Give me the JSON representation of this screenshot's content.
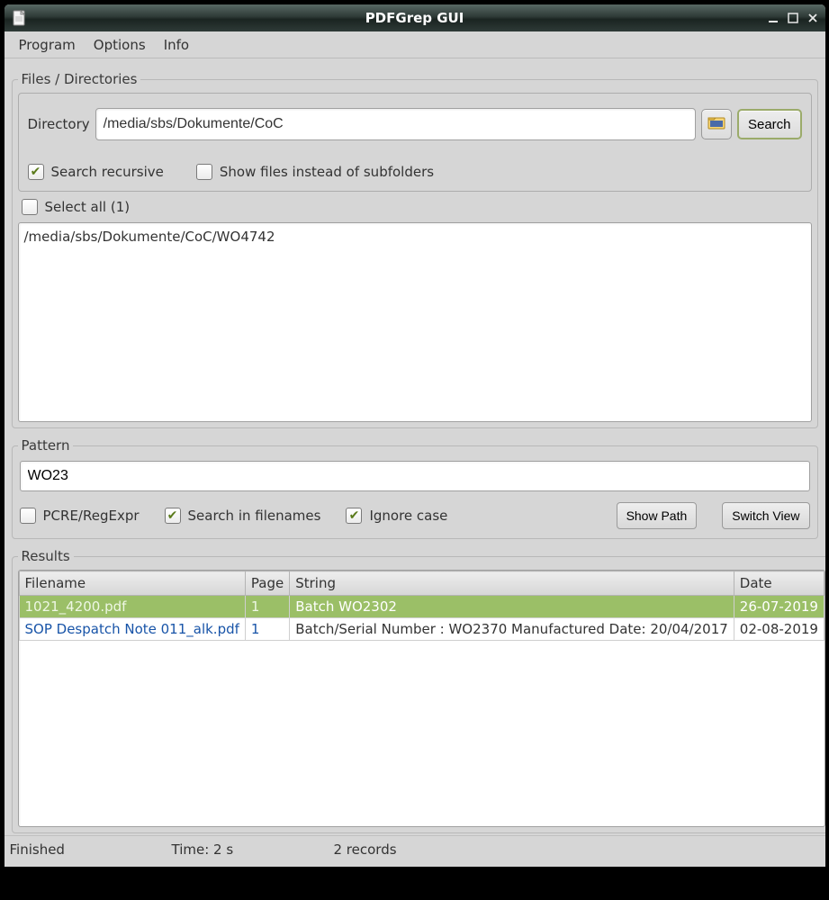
{
  "window": {
    "title": "PDFGrep GUI"
  },
  "menu": {
    "program": "Program",
    "options": "Options",
    "info": "Info"
  },
  "files": {
    "legend": "Files / Directories",
    "dir_label": "Directory",
    "dir_value": "/media/sbs/Dokumente/CoC",
    "search_button": "Search",
    "recursive_label": "Search recursive",
    "recursive_checked": true,
    "show_files_label": "Show files instead of subfolders",
    "show_files_checked": false,
    "select_all_label": "Select all (1)",
    "select_all_checked": false,
    "items": [
      "/media/sbs/Dokumente/CoC/WO4742"
    ]
  },
  "pattern": {
    "legend": "Pattern",
    "value": "WO23",
    "pcre_label": "PCRE/RegExpr",
    "pcre_checked": false,
    "filenames_label": "Search in filenames",
    "filenames_checked": true,
    "ignorecase_label": "Ignore case",
    "ignorecase_checked": true,
    "show_path": "Show Path",
    "switch_view": "Switch View"
  },
  "results": {
    "legend": "Results",
    "columns": {
      "filename": "Filename",
      "page": "Page",
      "string": "String",
      "date": "Date"
    },
    "rows": [
      {
        "filename": "1021_4200.pdf",
        "page": "1",
        "string": "Batch WO2302",
        "date": "26-07-2019",
        "selected": true
      },
      {
        "filename": "SOP Despatch Note 011_alk.pdf",
        "page": "1",
        "string": "Batch/Serial Number : WO2370 Manufactured Date: 20/04/2017",
        "date": "02-08-2019",
        "selected": false
      }
    ]
  },
  "status": {
    "state": "Finished",
    "time": "Time: 2 s",
    "records": "2  records"
  }
}
